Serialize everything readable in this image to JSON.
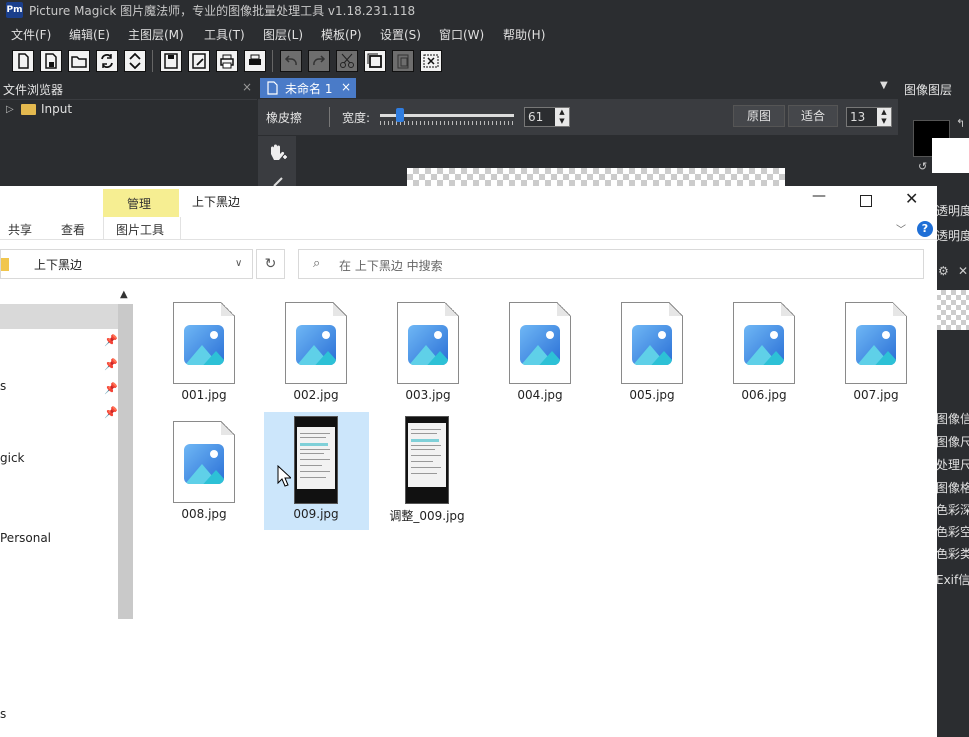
{
  "app": {
    "logo": "Pm",
    "title": "Picture Magick 图片魔法师，专业的图像批量处理工具 v1.18.231.118"
  },
  "menu": [
    "文件(F)",
    "编辑(E)",
    "主图层(M)",
    "工具(T)",
    "图层(L)",
    "模板(P)",
    "设置(S)",
    "窗口(W)",
    "帮助(H)"
  ],
  "file_browser": {
    "title": "文件浏览器",
    "close": "×",
    "tree_item": "Input"
  },
  "document_tab": {
    "label": "未命名 1",
    "close": "×"
  },
  "options": {
    "tool": "橡皮擦",
    "width_label": "宽度:",
    "width_value": "61",
    "original_button": "原图",
    "fit_button": "适合",
    "zoom_value": "13"
  },
  "layers": {
    "title": "图像图层",
    "opacity1": "透明度",
    "opacity2": "透明度",
    "info": [
      "图像信",
      "图像尺寸",
      "处理尺寸",
      "图像格式",
      "色彩深度",
      "色彩空间",
      "色彩类型",
      "Exif信"
    ]
  },
  "explorer": {
    "context_tab": "管理",
    "window_title": "上下黑边",
    "ribbon_tabs": {
      "share": "共享",
      "view": "查看",
      "picture_tools": "图片工具"
    },
    "address": "上下黑边",
    "search_placeholder": "在 上下黑边 中搜索",
    "nav_items": [
      "s",
      "gick",
      "Personal",
      "s"
    ],
    "files": [
      {
        "name": "001.jpg"
      },
      {
        "name": "002.jpg"
      },
      {
        "name": "003.jpg"
      },
      {
        "name": "004.jpg"
      },
      {
        "name": "005.jpg"
      },
      {
        "name": "006.jpg"
      },
      {
        "name": "007.jpg"
      },
      {
        "name": "008.jpg"
      },
      {
        "name": "009.jpg"
      },
      {
        "name": "调整_009.jpg"
      }
    ]
  },
  "colors": {
    "accent": "#4a7bc8",
    "selection": "#cce6fb",
    "context_tab": "#f6ee92"
  }
}
